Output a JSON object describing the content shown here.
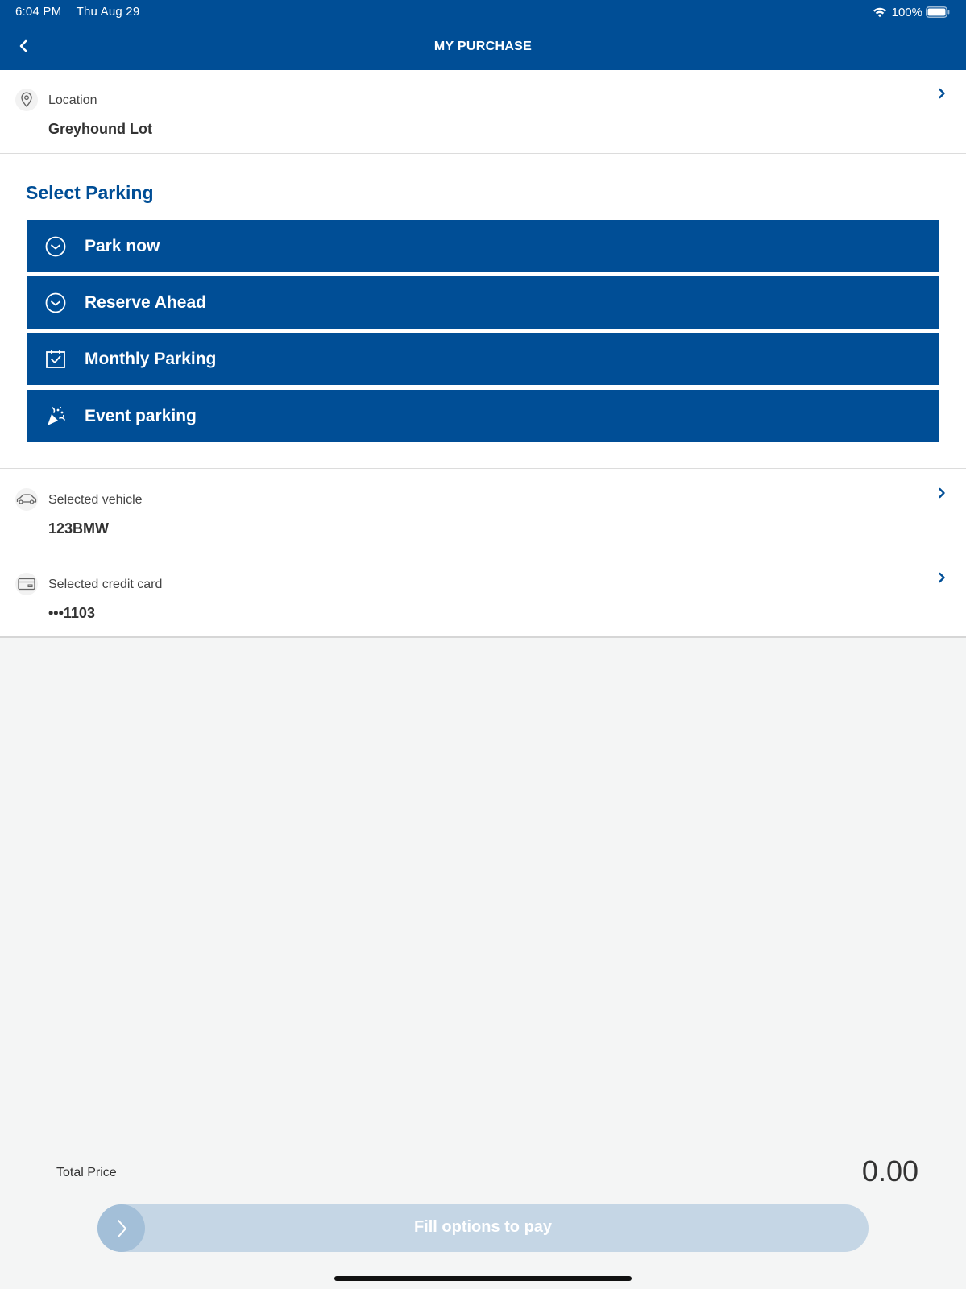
{
  "status_bar": {
    "time": "6:04 PM",
    "date": "Thu Aug 29",
    "battery": "100%"
  },
  "header": {
    "title": "MY PURCHASE"
  },
  "location": {
    "label": "Location",
    "value": "Greyhound Lot"
  },
  "select_parking": {
    "title": "Select Parking",
    "options": [
      {
        "label": "Park now",
        "icon": "clock-icon"
      },
      {
        "label": "Reserve Ahead",
        "icon": "clock-icon"
      },
      {
        "label": "Monthly Parking",
        "icon": "calendar-check-icon"
      },
      {
        "label": "Event parking",
        "icon": "party-popper-icon"
      }
    ]
  },
  "vehicle": {
    "label": "Selected vehicle",
    "value": "123BMW"
  },
  "credit_card": {
    "label": "Selected credit card",
    "value": "•••1103"
  },
  "footer": {
    "total_label": "Total Price",
    "total_value": "0.00",
    "pay_label": "Fill options to pay"
  },
  "colors": {
    "primary": "#004e96",
    "pay_disabled": "#c5d6e5",
    "background": "#f4f5f5"
  }
}
